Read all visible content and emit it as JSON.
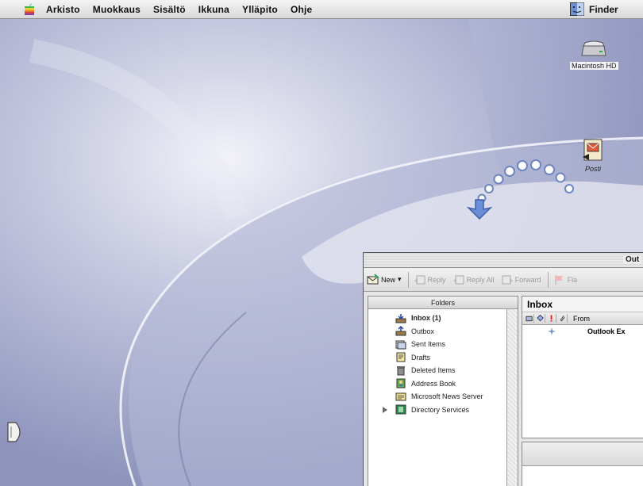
{
  "menubar": {
    "items": [
      "Arkisto",
      "Muokkaus",
      "Sisältö",
      "Ikkuna",
      "Ylläpito",
      "Ohje"
    ],
    "app": "Finder"
  },
  "desktop": {
    "icons": [
      {
        "label": "Macintosh HD",
        "icon": "hard-drive-icon"
      },
      {
        "label": "Posti",
        "icon": "mail-alias-icon"
      }
    ]
  },
  "outlook": {
    "title": "Out",
    "toolbar": [
      {
        "label": "New",
        "enabled": true
      },
      {
        "label": "Reply",
        "enabled": false
      },
      {
        "label": "Reply All",
        "enabled": false
      },
      {
        "label": "Forward",
        "enabled": false
      },
      {
        "label": "Fla",
        "enabled": false
      }
    ],
    "folders_header": "Folders",
    "folders": [
      {
        "label": "Inbox (1)",
        "bold": true,
        "icon": "inbox-icon"
      },
      {
        "label": "Outbox",
        "bold": false,
        "icon": "outbox-icon"
      },
      {
        "label": "Sent Items",
        "bold": false,
        "icon": "sent-items-icon"
      },
      {
        "label": "Drafts",
        "bold": false,
        "icon": "drafts-icon"
      },
      {
        "label": "Deleted Items",
        "bold": false,
        "icon": "deleted-items-icon"
      },
      {
        "label": "Address Book",
        "bold": false,
        "icon": "address-book-icon"
      },
      {
        "label": "Microsoft News Server",
        "bold": false,
        "icon": "news-server-icon"
      },
      {
        "label": "Directory Services",
        "bold": false,
        "icon": "directory-services-icon"
      }
    ],
    "list_title": "Inbox",
    "columns": {
      "from": "From"
    },
    "messages": [
      {
        "from": "Outlook Ex"
      }
    ]
  }
}
